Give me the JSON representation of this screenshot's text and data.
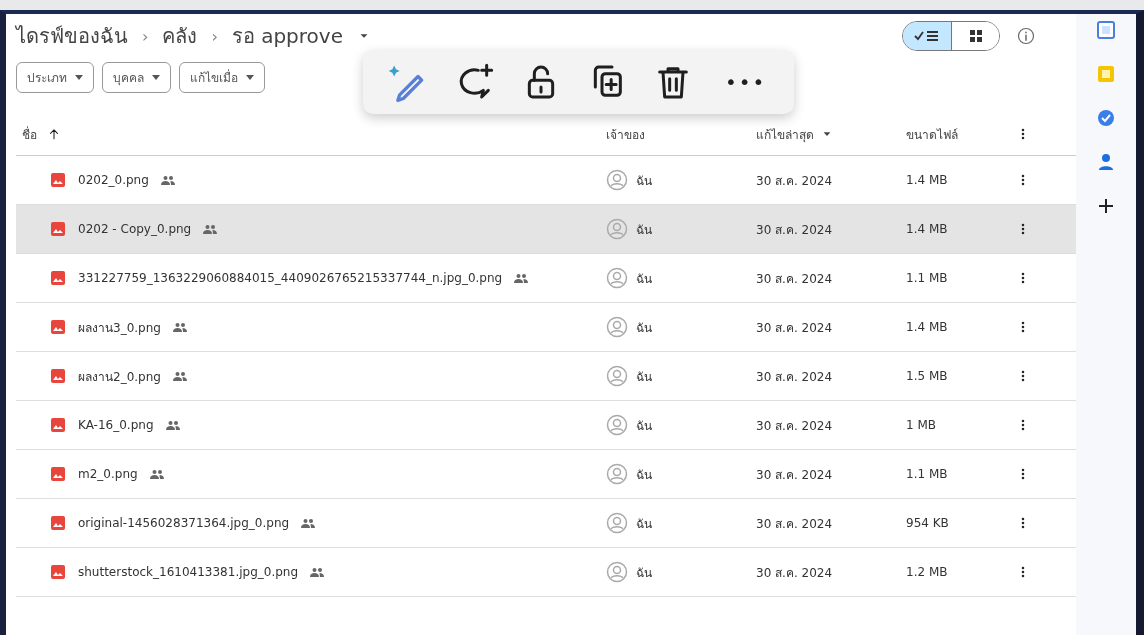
{
  "breadcrumb": [
    {
      "label": "ไดรฟ์ของฉัน"
    },
    {
      "label": "คลัง"
    },
    {
      "label": "รอ approve"
    }
  ],
  "breadcrumb_separator": "›",
  "filters": [
    {
      "label": "ประเภท"
    },
    {
      "label": "บุคคล"
    },
    {
      "label": "แก้ไขเมื่อ"
    }
  ],
  "view_toggle": [
    {
      "kind": "list",
      "selected": true
    },
    {
      "kind": "grid",
      "selected": false
    }
  ],
  "table": {
    "columns": [
      {
        "label": "ชื่อ"
      },
      {
        "label": "เจ้าของ"
      },
      {
        "label": "แก้ไขล่าสุด"
      },
      {
        "label": "ขนาดไฟล์"
      }
    ],
    "rows": [
      {
        "name": "0202_0.png",
        "owner": "ฉัน",
        "modified": "30 ส.ค. 2024",
        "size": "1.4 MB",
        "selected": false
      },
      {
        "name": "0202 - Copy_0.png",
        "owner": "ฉัน",
        "modified": "30 ส.ค. 2024",
        "size": "1.4 MB",
        "selected": true
      },
      {
        "name": "331227759_1363229060884015_4409026765215337744_n.jpg_0.png",
        "owner": "ฉัน",
        "modified": "30 ส.ค. 2024",
        "size": "1.1 MB",
        "selected": false
      },
      {
        "name": "ผลงาน3_0.png",
        "owner": "ฉัน",
        "modified": "30 ส.ค. 2024",
        "size": "1.4 MB",
        "selected": false
      },
      {
        "name": "ผลงาน2_0.png",
        "owner": "ฉัน",
        "modified": "30 ส.ค. 2024",
        "size": "1.5 MB",
        "selected": false
      },
      {
        "name": "KA-16_0.png",
        "owner": "ฉัน",
        "modified": "30 ส.ค. 2024",
        "size": "1 MB",
        "selected": false
      },
      {
        "name": "m2_0.png",
        "owner": "ฉัน",
        "modified": "30 ส.ค. 2024",
        "size": "1.1 MB",
        "selected": false
      },
      {
        "name": "original-1456028371364.jpg_0.png",
        "owner": "ฉัน",
        "modified": "30 ส.ค. 2024",
        "size": "954 KB",
        "selected": false
      },
      {
        "name": "shutterstock_1610413381.jpg_0.png",
        "owner": "ฉัน",
        "modified": "30 ส.ค. 2024",
        "size": "1.2 MB",
        "selected": false
      }
    ]
  },
  "toolbar_more": "•••"
}
